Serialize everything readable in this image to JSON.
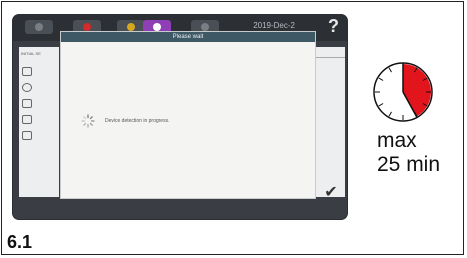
{
  "screen": {
    "date": "2019-Dec-2",
    "help_icon": "?",
    "sidebar_header": "INITIAL SE",
    "tabs": [
      {
        "icon": "home-icon",
        "color": "#7a7e84"
      },
      {
        "icon": "red-icon",
        "color": "#d42a2a"
      },
      {
        "icon": "yellow-icon",
        "color": "#d6a81e"
      },
      {
        "icon": "settings-icon",
        "color": "#a94dd0"
      },
      {
        "icon": "tab-icon",
        "color": "#7a7e84"
      }
    ]
  },
  "dialog": {
    "title": "Please wait",
    "message": "Device detection in progress."
  },
  "timer": {
    "line1": "max",
    "line2": "25 min",
    "fraction": 0.42,
    "accent": "#e2141c"
  },
  "figure_label": "6.1"
}
